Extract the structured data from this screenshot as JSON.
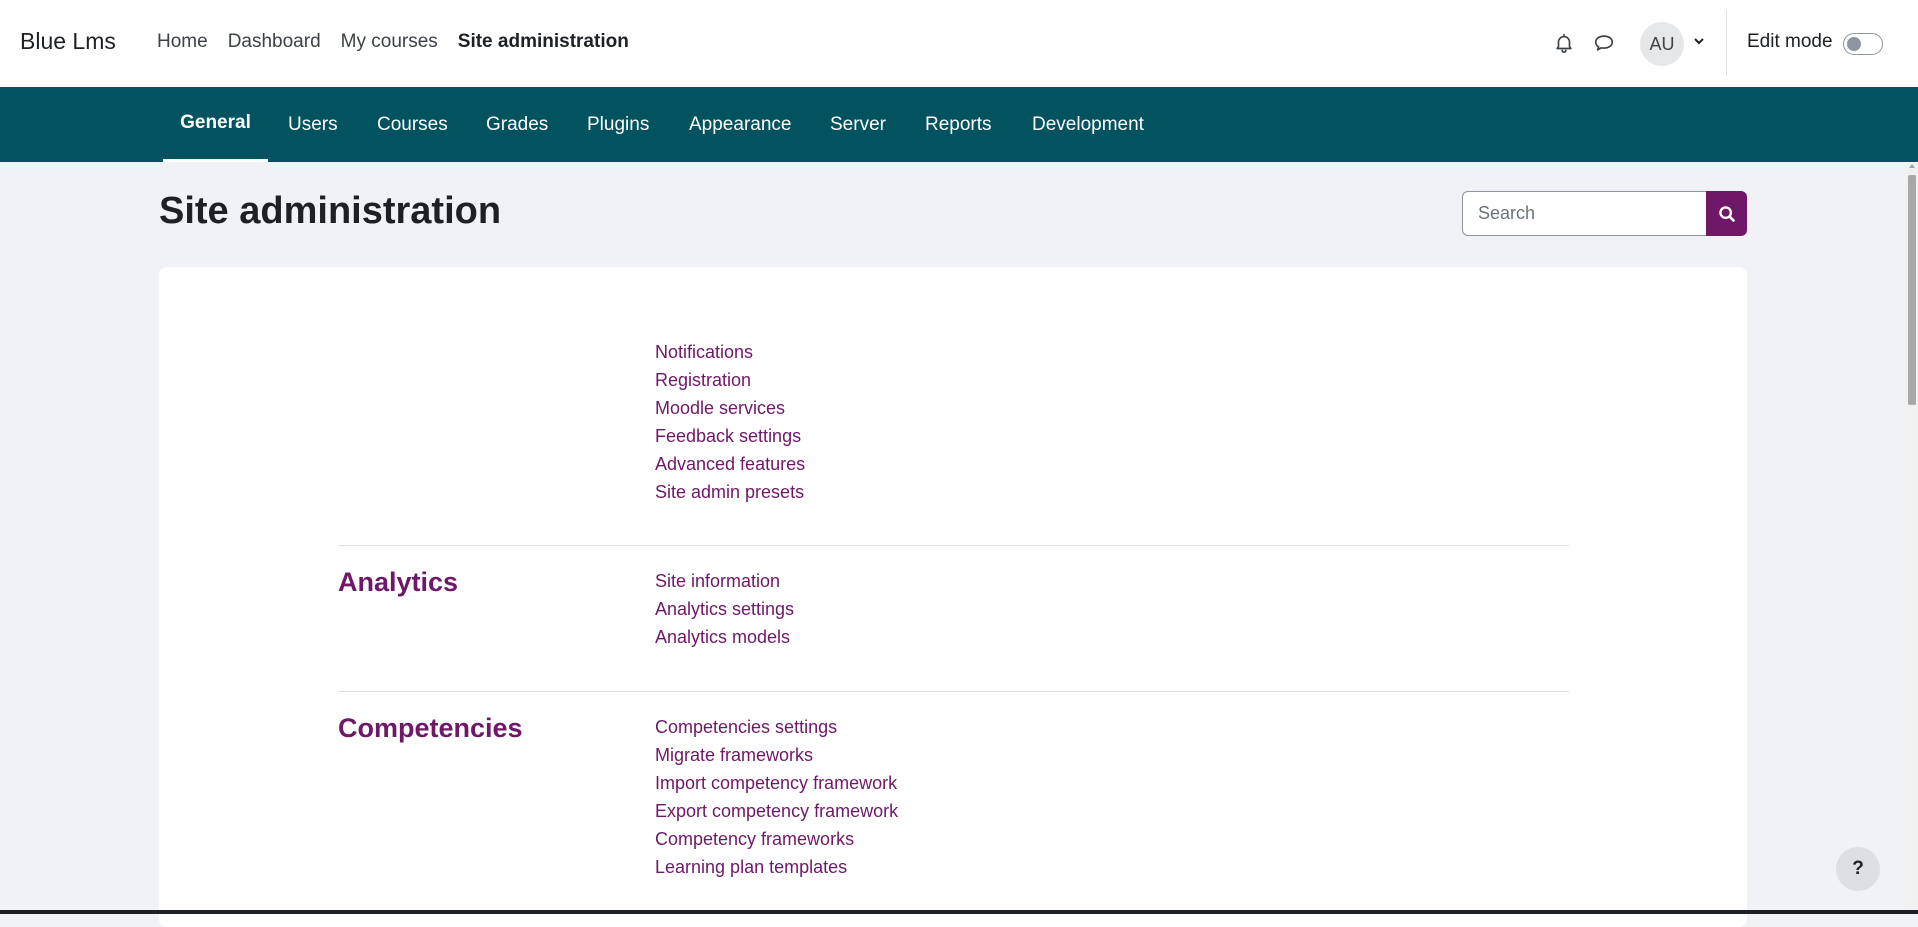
{
  "topbar": {
    "brand": "Blue Lms",
    "nav": [
      {
        "label": "Home"
      },
      {
        "label": "Dashboard"
      },
      {
        "label": "My courses"
      },
      {
        "label": "Site administration",
        "active": true
      }
    ],
    "avatar_initials": "AU",
    "edit_mode_label": "Edit mode",
    "edit_mode_on": false,
    "icons": [
      "bell-icon",
      "chat-icon",
      "chevron-down-icon"
    ]
  },
  "secondary_nav": {
    "tabs": [
      {
        "label": "General",
        "active": true
      },
      {
        "label": "Users"
      },
      {
        "label": "Courses"
      },
      {
        "label": "Grades"
      },
      {
        "label": "Plugins"
      },
      {
        "label": "Appearance"
      },
      {
        "label": "Server"
      },
      {
        "label": "Reports"
      },
      {
        "label": "Development"
      }
    ]
  },
  "main": {
    "title": "Site administration",
    "search": {
      "placeholder": "Search",
      "value": ""
    },
    "sections": [
      {
        "title": "",
        "links": [
          "Notifications",
          "Registration",
          "Moodle services",
          "Feedback settings",
          "Advanced features",
          "Site admin presets"
        ]
      },
      {
        "title": "Analytics",
        "links": [
          "Site information",
          "Analytics settings",
          "Analytics models"
        ]
      },
      {
        "title": "Competencies",
        "links": [
          "Competencies settings",
          "Migrate frameworks",
          "Import competency framework",
          "Export competency framework",
          "Competency frameworks",
          "Learning plan templates"
        ]
      }
    ]
  },
  "help_button": "?",
  "colors": {
    "brand_teal": "#02525f",
    "link_purple": "#6f1868",
    "page_bg": "#f1f2f5"
  }
}
